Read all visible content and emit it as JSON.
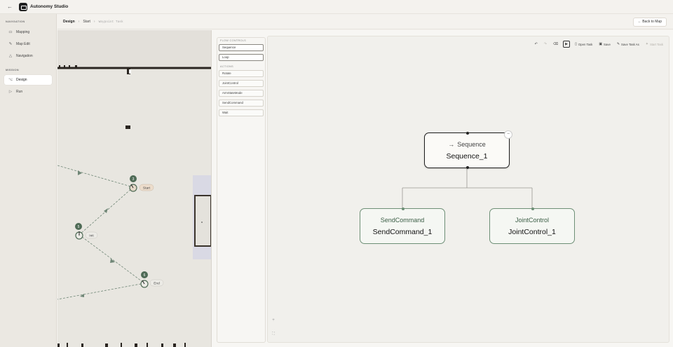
{
  "app": {
    "title": "Autonomy Studio",
    "back_icon": "arrow-left-icon",
    "logo_icon": "robot-logo-icon"
  },
  "sidebar": {
    "navigation_heading": "NAVIGATION",
    "navigation_items": [
      {
        "label": "Mapping",
        "icon": "map-icon"
      },
      {
        "label": "Map Edit",
        "icon": "pencil-icon"
      },
      {
        "label": "Navigation",
        "icon": "navigation-icon"
      }
    ],
    "mission_heading": "MISSION",
    "mission_items": [
      {
        "label": "Design",
        "icon": "design-icon",
        "active": true
      },
      {
        "label": "Run",
        "icon": "run-icon",
        "active": false
      }
    ]
  },
  "breadcrumb": {
    "items": [
      "Design",
      "Start",
      "Waypoint Task"
    ],
    "separator": "›",
    "back_button": "Back to Map",
    "back_icon": "arrow-left-icon"
  },
  "map": {
    "waypoints": [
      {
        "number": "3",
        "label": "Start"
      },
      {
        "number": "5",
        "label": "Init"
      },
      {
        "number": "6",
        "label": "End"
      }
    ]
  },
  "palette": {
    "flow_heading": "FLOW CONTROLS",
    "flow_items": [
      "Sequence",
      "Loop"
    ],
    "actions_heading": "ACTIONS",
    "action_items": [
      "Rotate",
      "JointControl",
      "ArmStateMode",
      "SendCommand",
      "Wait"
    ]
  },
  "toolbar": {
    "undo_icon": "undo-icon",
    "redo_icon": "redo-icon",
    "clear_icon": "eraser-icon",
    "play_icon": "play-icon",
    "open": "Open Task",
    "save": "Save",
    "save_as": "Save Task As",
    "start": "Start Task"
  },
  "tree": {
    "root": {
      "type": "Sequence",
      "name": "Sequence_1",
      "icon": "arrow-right-icon"
    },
    "children": [
      {
        "type": "SendCommand",
        "name": "SendCommand_1"
      },
      {
        "type": "JointControl",
        "name": "JointControl_1"
      }
    ],
    "collapse_label": "−"
  },
  "zoom": {
    "plus": "+",
    "fit": "⛶"
  },
  "colors": {
    "accent": "#222222",
    "waypoint": "#4f6b56",
    "action_border": "#6e8f76"
  }
}
